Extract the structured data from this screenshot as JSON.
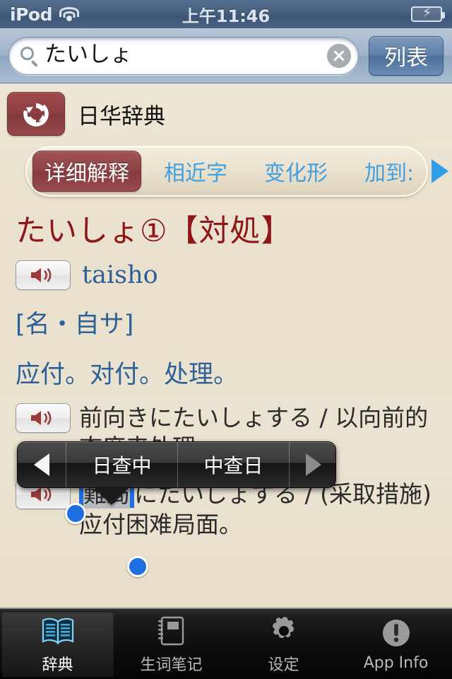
{
  "statusbar": {
    "carrier": "iPod",
    "time": "上午11:46",
    "wifi_icon": "wifi-icon",
    "battery_icon": "battery-charging-icon"
  },
  "search": {
    "value": "たいしょ",
    "placeholder": "",
    "search_icon": "search-icon",
    "clear_icon": "clear-icon",
    "list_button": "列表"
  },
  "dictionary": {
    "refresh_icon": "refresh-icon",
    "name": "日华辞典"
  },
  "tabs": {
    "items": [
      {
        "label": "详细解释",
        "active": true
      },
      {
        "label": "相近字",
        "active": false
      },
      {
        "label": "变化形",
        "active": false
      },
      {
        "label": "加到:",
        "active": false
      }
    ],
    "more_icon": "chevron-right-icon"
  },
  "entry": {
    "headword": "たいしょ①【対処】",
    "speaker_icon": "speaker-icon",
    "romaji": "taisho",
    "part_of_speech": "[名・自サ]",
    "definitions": "应付。对付。处理。",
    "examples": [
      {
        "text": "前向きにたいしょする / 以向前的态度来处理。",
        "speaker_icon": "speaker-icon"
      },
      {
        "prefix": "",
        "selected": "難局",
        "suffix": "にたいしょする / (采取措施)应付困难局面。",
        "speaker_icon": "speaker-icon"
      }
    ]
  },
  "popup": {
    "prev_icon": "triangle-left-icon",
    "next_icon": "triangle-right-icon",
    "items": [
      {
        "label": "日查中"
      },
      {
        "label": "中查日"
      }
    ]
  },
  "tabbar": {
    "items": [
      {
        "label": "辞典",
        "icon": "open-book-icon",
        "active": true
      },
      {
        "label": "生词笔记",
        "icon": "notebook-icon",
        "active": false
      },
      {
        "label": "设定",
        "icon": "gear-icon",
        "active": false
      },
      {
        "label": "App Info",
        "icon": "info-exclamation-icon",
        "active": false
      }
    ]
  },
  "colors": {
    "accent_red": "#8e1616",
    "link_blue": "#2d6095",
    "tab_blue": "#3f9fe0",
    "paper": "#ece3d0",
    "selection_blue": "#1f6fe0"
  }
}
